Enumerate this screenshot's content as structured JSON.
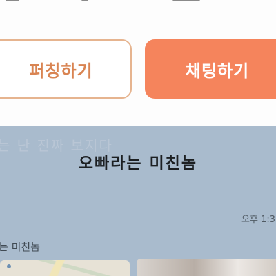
{
  "buttons": {
    "secondary_label": "퍼칭하기",
    "primary_label": "채팅하기"
  },
  "chat": {
    "faded_overlay_text": "는 난 진짜 보지다",
    "room_title": "오빠라는 미친놈",
    "timestamp": "오후 1:3",
    "sender_name": "는 미친놈"
  },
  "colors": {
    "outline_border": "#e6b48f",
    "outline_text": "#d98452",
    "primary_button": "#f5845c",
    "chat_background": "#a9bbcd"
  }
}
